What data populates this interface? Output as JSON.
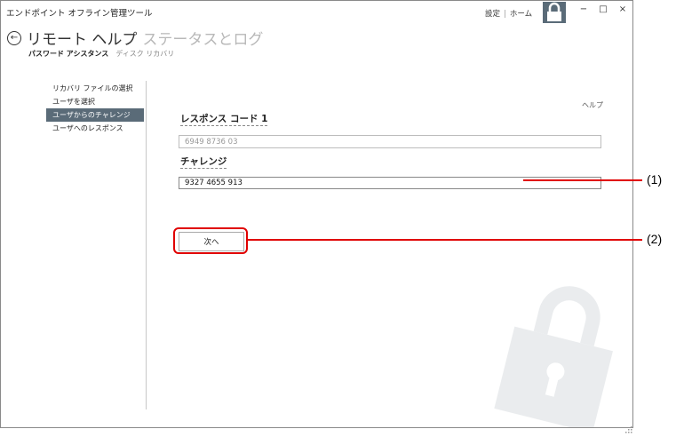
{
  "app": {
    "title": "エンドポイント オフライン管理ツール",
    "settings_link": "設定",
    "home_link": "ホーム",
    "minimize": "−",
    "maximize": "□",
    "close": "×"
  },
  "header": {
    "title": "リモート ヘルプ",
    "title_inactive": "ステータスとログ",
    "subtabs": {
      "active": "パスワード アシスタンス",
      "inactive": "ディスク リカバリ"
    }
  },
  "sidebar": {
    "steps": [
      {
        "label": "リカバリ ファイルの選択"
      },
      {
        "label": "ユーザを選択"
      },
      {
        "label": "ユーザからのチャレンジ"
      },
      {
        "label": "ユーザへのレスポンス"
      }
    ]
  },
  "main": {
    "help": "ヘルプ",
    "response_code_label": "レスポンス コード 1",
    "response_code_value": "6949 8736 03",
    "challenge_label": "チャレンジ",
    "challenge_value": "9327 4655 913",
    "next_button": "次へ"
  },
  "annotations": {
    "callout_1": "(1)",
    "callout_2": "(2)",
    "color": "#e00000"
  },
  "colors": {
    "accent": "#5a6b78"
  }
}
